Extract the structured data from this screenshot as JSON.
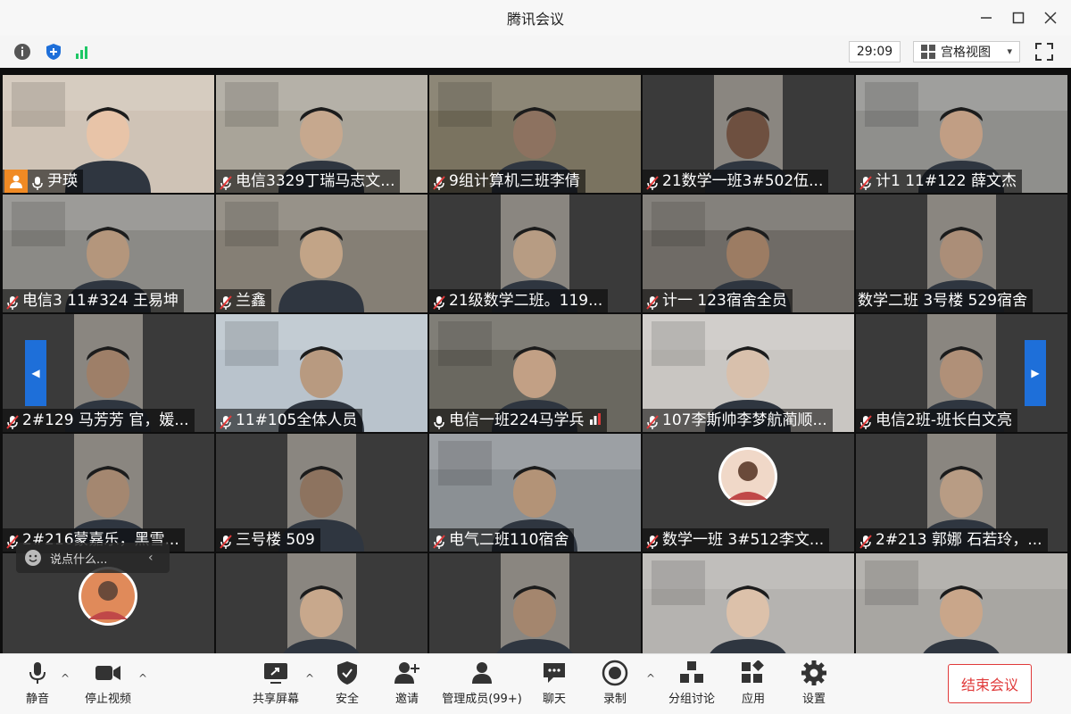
{
  "window": {
    "title": "腾讯会议",
    "minimize": "—",
    "maximize": "☐",
    "close": "✕"
  },
  "toolbar": {
    "timer": "29:09",
    "view_mode": "宫格视图"
  },
  "participants": [
    {
      "name": "尹瑛",
      "bg": "#cfc3b6",
      "face": "#e8c4a8",
      "active": true,
      "host": true
    },
    {
      "name": "电信3329丁瑞马志文...",
      "bg": "#a9a499",
      "face": "#c6a88e"
    },
    {
      "name": "9组计算机三班李倩",
      "bg": "#7a7360",
      "face": "#8d7260"
    },
    {
      "name": "21数学一班3#502伍...",
      "bg": "#3a3a3a",
      "face": "#6e5040"
    },
    {
      "name": "计1 11#122 薛文杰",
      "bg": "#8f8f8c",
      "face": "#c19e84"
    },
    {
      "name": "电信3 11#324 王易坤",
      "bg": "#8b8a86",
      "face": "#b4967c"
    },
    {
      "name": "兰鑫",
      "bg": "#857f75",
      "face": "#c2a487"
    },
    {
      "name": "21级数学二班。119...",
      "bg": "#3a3a3a",
      "face": "#b79c83"
    },
    {
      "name": "计一  123宿舍全员",
      "bg": "#6f6b66",
      "face": "#9c7c63"
    },
    {
      "name": "数学二班   3号楼 529宿舍",
      "bg": "#3a3a3a",
      "face": "#ab8e78",
      "nomic": true
    },
    {
      "name": "2#129 马芳芳 官，媛...",
      "bg": "#3a3a3a",
      "face": "#9e7f68"
    },
    {
      "name": "11#105全体人员",
      "bg": "#b9c3cc",
      "face": "#b89a80"
    },
    {
      "name": "电信一班224马学兵",
      "bg": "#6a6860",
      "face": "#c2a085",
      "speaking": true
    },
    {
      "name": "107李斯帅李梦航蔺顺...",
      "bg": "#c9c6c2",
      "face": "#d8c0ac"
    },
    {
      "name": "电信2班-班长白文亮",
      "bg": "#3a3a3a",
      "face": "#b09078"
    },
    {
      "name": "2#216蒙嘉乐，黑雪...",
      "bg": "#3a3a3a",
      "face": "#a48770"
    },
    {
      "name": "三号楼  509",
      "bg": "#3a3a3a",
      "face": "#8d735f"
    },
    {
      "name": "电气二班110宿舍",
      "bg": "#8b9094",
      "face": "#b39377"
    },
    {
      "name": "数学一班 3#512李文...",
      "bg": "#3a3a3a",
      "face": "#f0d8c8",
      "avatar": true
    },
    {
      "name": "2#213 郭娜 石若玲，...",
      "bg": "#3a3a3a",
      "face": "#b89c84"
    },
    {
      "name": "",
      "bg": "#3a3a3a",
      "face": "#e08a5a",
      "avatar": true
    },
    {
      "name": "",
      "bg": "#3a3a3a",
      "face": "#c8a88c"
    },
    {
      "name": "",
      "bg": "#3a3a3a",
      "face": "#a4866e"
    },
    {
      "name": "",
      "bg": "#b5b3b0",
      "face": "#dcc1aa"
    },
    {
      "name": "",
      "bg": "#a8a6a2",
      "face": "#c9a68a"
    }
  ],
  "chat": {
    "placeholder": "说点什么..."
  },
  "bottombar": {
    "mute": "静音",
    "stop_video": "停止视频",
    "share_screen": "共享屏幕",
    "security": "安全",
    "invite": "邀请",
    "manage_members": "管理成员(99+)",
    "chat": "聊天",
    "record": "录制",
    "breakout": "分组讨论",
    "apps": "应用",
    "settings": "设置",
    "end_meeting": "结束会议"
  },
  "colors": {
    "accent_blue": "#1e6fd9",
    "end_red": "#e03a3a",
    "active_green": "#1ec765",
    "mic_muted_red": "#e03a3a"
  }
}
